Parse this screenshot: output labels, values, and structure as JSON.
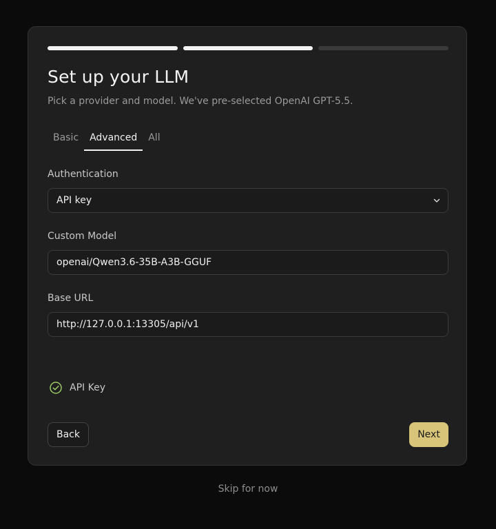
{
  "progress": {
    "total_steps": 3,
    "completed_steps": 2
  },
  "header": {
    "title": "Set up your LLM",
    "subtitle": "Pick a provider and model. We've pre-selected OpenAI GPT-5.5."
  },
  "tabs": [
    {
      "label": "Basic",
      "active": false
    },
    {
      "label": "Advanced",
      "active": true
    },
    {
      "label": "All",
      "active": false
    }
  ],
  "form": {
    "authentication": {
      "label": "Authentication",
      "value": "API key"
    },
    "custom_model": {
      "label": "Custom Model",
      "value": "openai/Qwen3.6-35B-A3B-GGUF"
    },
    "base_url": {
      "label": "Base URL",
      "value": "http://127.0.0.1:13305/api/v1"
    },
    "api_key": {
      "label": "API Key",
      "value": "••••••••••••••",
      "status": "verified"
    }
  },
  "footer": {
    "back_label": "Back",
    "next_label": "Next",
    "skip_label": "Skip for now"
  },
  "colors": {
    "accent": "#d8c57a",
    "verified": "#9ccc65",
    "background": "#0b0b0b",
    "card": "#1f1f1f"
  },
  "icons": {
    "select_chevron": "chevron-down-icon",
    "api_key_status": "check-circle-icon"
  }
}
